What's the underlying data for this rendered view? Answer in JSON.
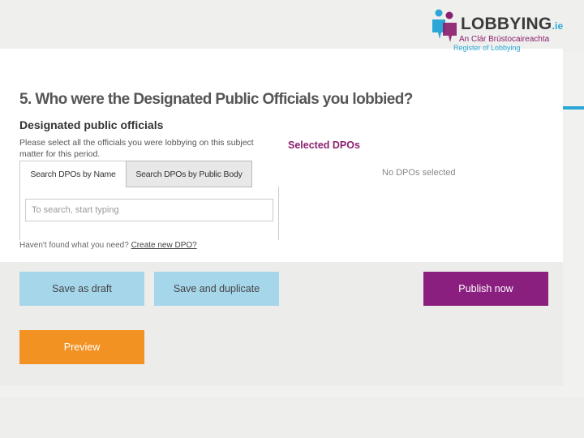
{
  "logo": {
    "wordmark": "LOBBYING",
    "tld": ".ie",
    "subtitle_ga": "An Clár Brústocaireachta",
    "subtitle_en": "Register of Lobbying",
    "colors": {
      "blue": "#2aa7d6",
      "purple": "#8b1f6f"
    }
  },
  "page": {
    "title": "5. Who were the Designated Public Officials you lobbied?",
    "section_heading": "Designated public officials",
    "instructions": "Please select all the officials you were lobbying on this subject matter for this period."
  },
  "tabs": [
    {
      "label": "Search DPOs by Name",
      "active": true
    },
    {
      "label": "Search DPOs by Public Body",
      "active": false
    }
  ],
  "search": {
    "placeholder": "To search, start typing",
    "value": ""
  },
  "not_found": {
    "text": "Haven't found what you need?",
    "link": "Create new DPO?"
  },
  "selected": {
    "heading": "Selected DPOs",
    "empty_text": "No DPOs selected"
  },
  "buttons": {
    "save_draft": "Save as draft",
    "save_duplicate": "Save and duplicate",
    "publish": "Publish now",
    "preview": "Preview"
  },
  "colors": {
    "accent_blue": "#a6d6ea",
    "publish_purple": "#8b1f7f",
    "preview_orange": "#f29222",
    "heading_purple": "#8b1f6f"
  }
}
